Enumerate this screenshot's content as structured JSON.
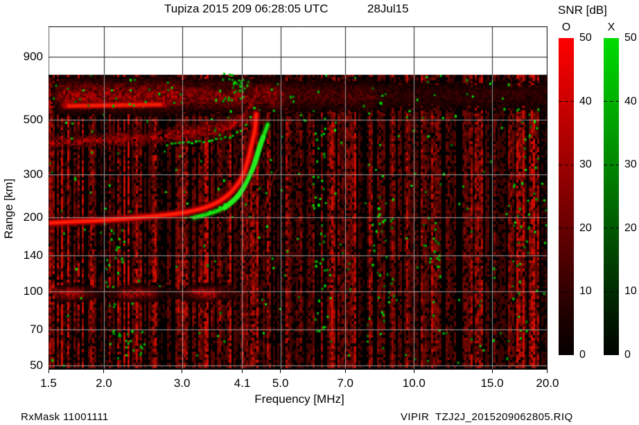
{
  "title": {
    "main": "Tupiza 2015 209 06:28:05 UTC",
    "date": "28Jul15"
  },
  "axes": {
    "x_label": "Frequency [MHz]",
    "y_label": "Range [km]",
    "x_ticks": [
      {
        "label": "1.5",
        "value": 1.5
      },
      {
        "label": "2.0",
        "value": 2.0
      },
      {
        "label": "3.0",
        "value": 3.0
      },
      {
        "label": "4.1",
        "value": 4.1
      },
      {
        "label": "5.0",
        "value": 5.0
      },
      {
        "label": "7.0",
        "value": 7.0
      },
      {
        "label": "10.0",
        "value": 10.0
      },
      {
        "label": "15.0",
        "value": 15.0
      },
      {
        "label": "20.0",
        "value": 20.0
      }
    ],
    "y_ticks": [
      {
        "label": "50",
        "value": 50
      },
      {
        "label": "70",
        "value": 70
      },
      {
        "label": "100",
        "value": 100
      },
      {
        "label": "140",
        "value": 140
      },
      {
        "label": "200",
        "value": 200
      },
      {
        "label": "300",
        "value": 300
      },
      {
        "label": "500",
        "value": 500
      },
      {
        "label": "900",
        "value": 900
      }
    ]
  },
  "colorbar": {
    "title": "SNR [dB]",
    "o_label": "O",
    "x_label": "X",
    "ticks": [
      {
        "label": "50",
        "db": 50
      },
      {
        "label": "40",
        "db": 40
      },
      {
        "label": "30",
        "db": 30
      },
      {
        "label": "20",
        "db": 20
      },
      {
        "label": "10",
        "db": 10
      },
      {
        "label": "0",
        "db": 0
      }
    ],
    "dash_ticks_db": [
      40,
      30,
      20,
      10
    ],
    "o_color": "#ff0000",
    "x_color": "#00dc00"
  },
  "footer": {
    "left": "RxMask 11001111",
    "right": "VIPIR  TZJ2J_2015209062805.RIQ"
  },
  "chart_data": {
    "type": "heatmap",
    "title": "Tupiza 2015 209 06:28:05 UTC",
    "xlabel": "Frequency [MHz]",
    "ylabel": "Range [km]",
    "x_scale": "log",
    "y_scale": "log",
    "x_range_mhz": [
      1.5,
      20
    ],
    "y_range_km": [
      47,
      1200
    ],
    "x_ticks_mhz": [
      1.5,
      2.0,
      3.0,
      4.1,
      5.0,
      7.0,
      10.0,
      15.0,
      20.0
    ],
    "y_ticks_km": [
      50,
      70,
      100,
      140,
      200,
      300,
      500,
      900
    ],
    "masked_above_km": 760,
    "colorbar": {
      "label": "SNR [dB]",
      "min_db": 0,
      "max_db": 50,
      "tick_step_db": 10,
      "o_polarization": "red",
      "x_polarization": "green"
    },
    "critical_freq_fof2_mhz": 4.4,
    "o_trace_f_km": [
      [
        1.5,
        190
      ],
      [
        1.66,
        192
      ],
      [
        1.92,
        194
      ],
      [
        2.23,
        198
      ],
      [
        2.58,
        202
      ],
      [
        2.93,
        207
      ],
      [
        3.26,
        215
      ],
      [
        3.54,
        226
      ],
      [
        3.77,
        242
      ],
      [
        3.96,
        265
      ],
      [
        4.1,
        291
      ],
      [
        4.21,
        332
      ],
      [
        4.3,
        394
      ],
      [
        4.38,
        448
      ],
      [
        4.4,
        497
      ],
      [
        4.41,
        527
      ]
    ],
    "x_trace_f_km": [
      [
        3.19,
        200
      ],
      [
        3.47,
        207
      ],
      [
        3.74,
        219
      ],
      [
        3.96,
        237
      ],
      [
        4.1,
        259
      ],
      [
        4.24,
        293
      ],
      [
        4.38,
        332
      ],
      [
        4.47,
        380
      ],
      [
        4.57,
        425
      ],
      [
        4.63,
        453
      ],
      [
        4.68,
        478
      ]
    ],
    "second_hop_trace_f_km": [
      [
        1.51,
        406
      ],
      [
        2.0,
        417
      ],
      [
        2.58,
        428
      ],
      [
        3.0,
        444
      ],
      [
        3.44,
        456
      ],
      [
        3.82,
        478
      ],
      [
        4.06,
        500
      ],
      [
        4.24,
        561
      ],
      [
        4.38,
        639
      ],
      [
        4.43,
        724
      ]
    ],
    "spread_f_band": {
      "freq_mhz": [
        1.5,
        20
      ],
      "range_km": [
        530,
        760
      ],
      "bright_streak": {
        "freq_mhz": [
          1.64,
          2.72
        ],
        "range_km": [
          558,
          587
        ]
      }
    },
    "e_region_band": {
      "freq_mhz": [
        1.55,
        4.0
      ],
      "range_km": [
        92,
        107
      ]
    }
  }
}
